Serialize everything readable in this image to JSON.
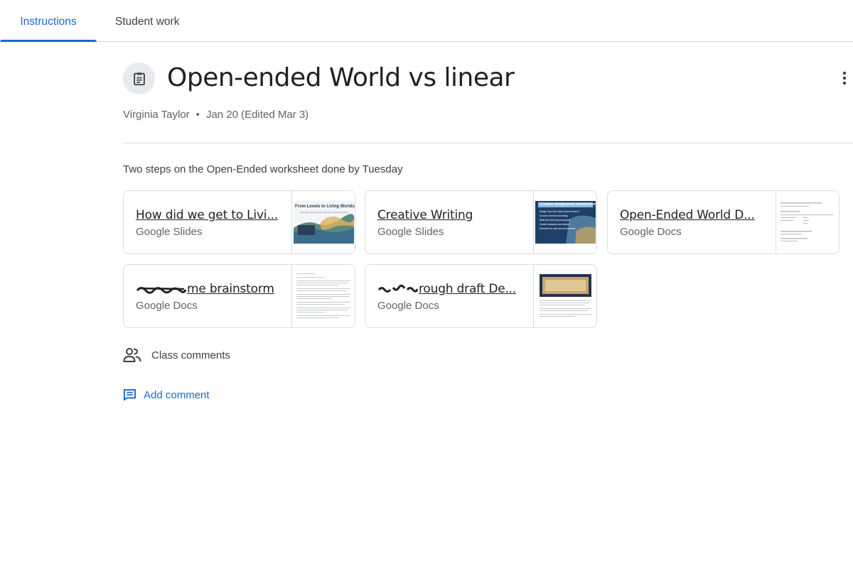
{
  "tabs": [
    {
      "label": "Instructions",
      "active": true
    },
    {
      "label": "Student work",
      "active": false
    }
  ],
  "assignment": {
    "icon": "assignment-icon",
    "title": "Open-ended World vs linear",
    "author": "Virginia Taylor",
    "separator": "•",
    "date": "Jan 20 (Edited Mar 3)",
    "description": "Two steps on the Open-Ended worksheet done by Tuesday"
  },
  "attachments": [
    {
      "name": "How did we get to Livi...",
      "type": "Google Slides",
      "thumb_title": "From Levels to Living Worlds",
      "thumb_sub": "How Open-Ended Game Worlds Transformed Play"
    },
    {
      "name": "Creative Writing",
      "type": "Google Slides",
      "thumb_title": "Creative Assignment Introduction",
      "thumb_lines": [
        "Design Your Own Open-Ended Game World",
        "Choose a theme and setting",
        "Write the main story and quest",
        "Create characters and regions",
        "Describe the rules and environment"
      ]
    },
    {
      "name": "Open-Ended World D...",
      "type": "Google Docs"
    },
    {
      "name": "me brainstorm",
      "type": "Google Docs"
    },
    {
      "name": "rough draft De...",
      "type": "Google Docs"
    }
  ],
  "comments": {
    "class_comments_label": "Class comments",
    "add_comment_label": "Add comment"
  },
  "colors": {
    "accent": "#1967d2",
    "text": "#3c4043",
    "muted": "#5f6368",
    "border": "#dadce0"
  }
}
